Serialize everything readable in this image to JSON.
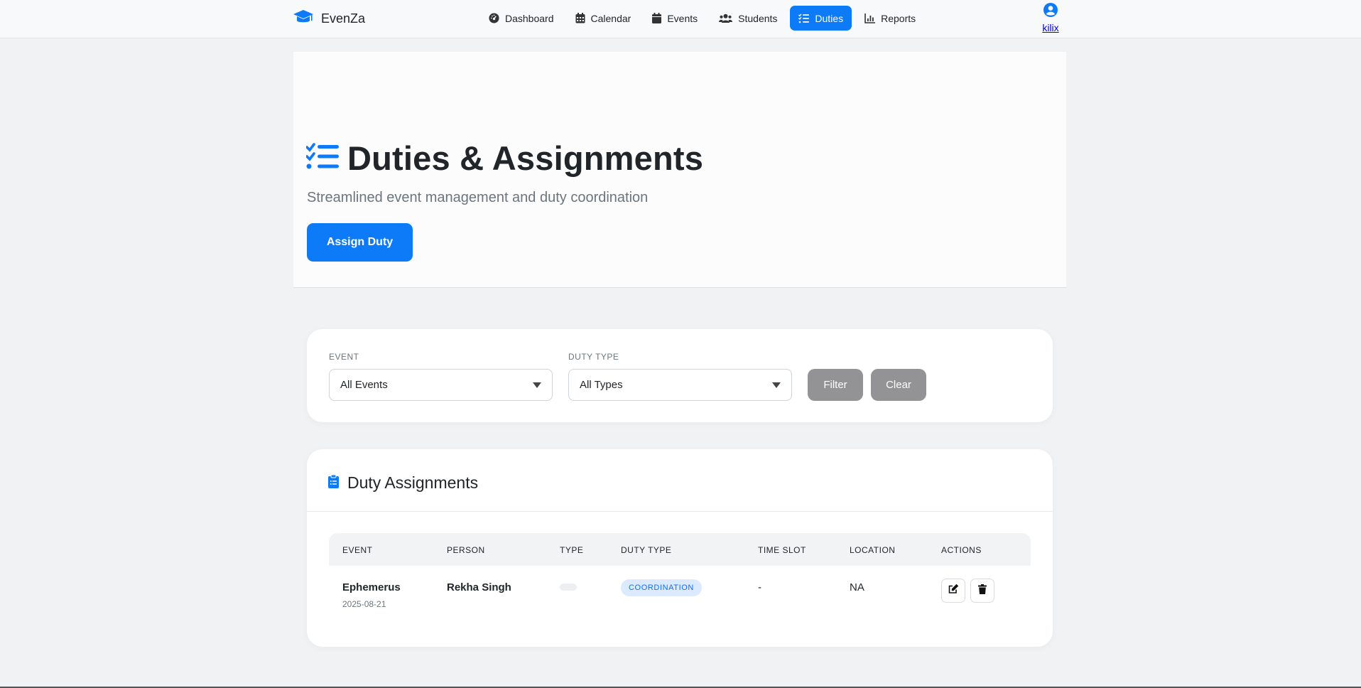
{
  "app": {
    "brand": "EvenZa",
    "accent": "#0d7bf7"
  },
  "nav": {
    "items": [
      {
        "label": "Dashboard",
        "icon": "gauge-icon"
      },
      {
        "label": "Calendar",
        "icon": "calendar-icon"
      },
      {
        "label": "Events",
        "icon": "calendar-solid-icon"
      },
      {
        "label": "Students",
        "icon": "users-icon"
      },
      {
        "label": "Duties",
        "icon": "tasks-icon",
        "active": true
      },
      {
        "label": "Reports",
        "icon": "chart-icon"
      }
    ]
  },
  "user": {
    "name": "kilix",
    "icon": "user-circle-icon"
  },
  "hero": {
    "title": "Duties & Assignments",
    "subtitle": "Streamlined event management and duty coordination",
    "assign_button": "Assign Duty"
  },
  "filters": {
    "event_label": "EVENT",
    "event_value": "All Events",
    "duty_type_label": "DUTY TYPE",
    "duty_type_value": "All Types",
    "filter_button": "Filter",
    "clear_button": "Clear"
  },
  "assignments": {
    "title": "Duty Assignments",
    "columns": [
      "EVENT",
      "PERSON",
      "TYPE",
      "DUTY TYPE",
      "TIME SLOT",
      "LOCATION",
      "ACTIONS"
    ],
    "rows": [
      {
        "event": "Ephemerus",
        "date": "2025-08-21",
        "person": "Rekha Singh",
        "type": "",
        "duty_type": "COORDINATION",
        "time_slot": "-",
        "location": "NA"
      }
    ]
  }
}
